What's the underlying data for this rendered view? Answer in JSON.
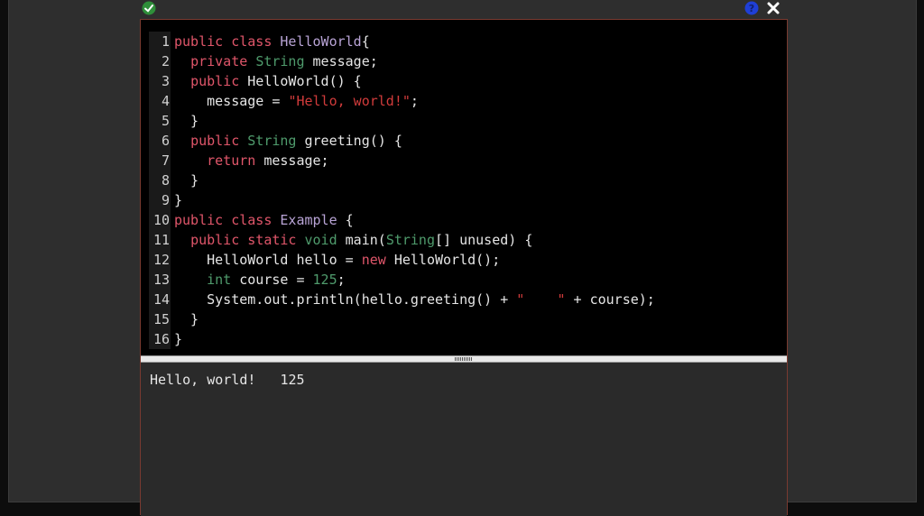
{
  "icons": {
    "status": "check-circle-icon",
    "help": "question-circle-icon",
    "close": "close-icon"
  },
  "colors": {
    "keyword": "#e0566a",
    "type": "#4f9b6c",
    "class_name": "#b9a4d6",
    "string": "#d13b3b",
    "panel_border": "#7a3a30"
  },
  "editor": {
    "lines": [
      {
        "n": "1",
        "tokens": [
          [
            "kw",
            "public class "
          ],
          [
            "cls",
            "HelloWorld"
          ],
          [
            "",
            "{"
          ]
        ]
      },
      {
        "n": "2",
        "tokens": [
          [
            "",
            "  "
          ],
          [
            "kw",
            "private "
          ],
          [
            "ty",
            "String "
          ],
          [
            "",
            "message;"
          ]
        ]
      },
      {
        "n": "3",
        "tokens": [
          [
            "",
            "  "
          ],
          [
            "kw",
            "public "
          ],
          [
            "",
            "HelloWorld() {"
          ]
        ]
      },
      {
        "n": "4",
        "tokens": [
          [
            "",
            "    message = "
          ],
          [
            "str",
            "\"Hello, world!\""
          ],
          [
            "",
            ";"
          ]
        ]
      },
      {
        "n": "5",
        "tokens": [
          [
            "",
            "  }"
          ]
        ]
      },
      {
        "n": "6",
        "tokens": [
          [
            "",
            "  "
          ],
          [
            "kw",
            "public "
          ],
          [
            "ty",
            "String "
          ],
          [
            "",
            "greeting() {"
          ]
        ]
      },
      {
        "n": "7",
        "tokens": [
          [
            "",
            "    "
          ],
          [
            "kw",
            "return "
          ],
          [
            "",
            "message;"
          ]
        ]
      },
      {
        "n": "8",
        "tokens": [
          [
            "",
            "  }"
          ]
        ]
      },
      {
        "n": "9",
        "tokens": [
          [
            "",
            "}"
          ]
        ]
      },
      {
        "n": "10",
        "tokens": [
          [
            "kw",
            "public class "
          ],
          [
            "cls",
            "Example "
          ],
          [
            "",
            "{"
          ]
        ]
      },
      {
        "n": "11",
        "tokens": [
          [
            "",
            "  "
          ],
          [
            "kw",
            "public static "
          ],
          [
            "ty",
            "void "
          ],
          [
            "",
            "main("
          ],
          [
            "ty",
            "String"
          ],
          [
            "",
            "[] unused) {"
          ]
        ]
      },
      {
        "n": "12",
        "tokens": [
          [
            "",
            "    HelloWorld hello = "
          ],
          [
            "kw",
            "new "
          ],
          [
            "",
            "HelloWorld();"
          ]
        ]
      },
      {
        "n": "13",
        "tokens": [
          [
            "",
            "    "
          ],
          [
            "ty",
            "int "
          ],
          [
            "",
            "course = "
          ],
          [
            "num",
            "125"
          ],
          [
            "",
            ";"
          ]
        ]
      },
      {
        "n": "14",
        "tokens": [
          [
            "",
            "    System.out.println(hello.greeting() + "
          ],
          [
            "str",
            "\"    \""
          ],
          [
            "",
            " + course);"
          ]
        ]
      },
      {
        "n": "15",
        "tokens": [
          [
            "",
            "  }"
          ]
        ]
      },
      {
        "n": "16",
        "tokens": [
          [
            "",
            "}"
          ]
        ]
      }
    ]
  },
  "output": {
    "text": "Hello, world!   125"
  }
}
